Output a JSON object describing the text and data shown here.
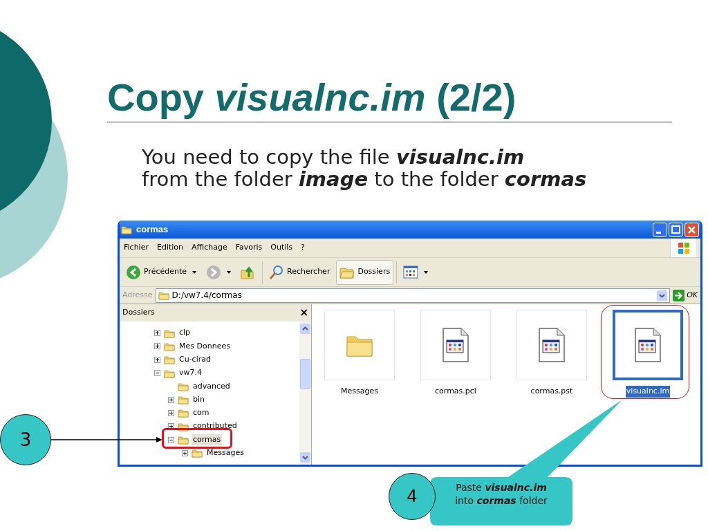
{
  "slide": {
    "title": "Copy *visualnc.im* (2/2)",
    "body": "You need to copy the file **visualnc.im**\nfrom the folder **image** to the folder **cormas**"
  },
  "window": {
    "title": "cormas",
    "menu": [
      {
        "label": "Fichier"
      },
      {
        "label": "Edition"
      },
      {
        "label": "Affichage"
      },
      {
        "label": "Favoris"
      },
      {
        "label": "Outils"
      },
      {
        "label": "?"
      }
    ],
    "toolbar": [
      {
        "kind": "back",
        "label": "Précédente",
        "pressed": false
      },
      {
        "kind": "forward",
        "pressed": false
      },
      {
        "kind": "up",
        "pressed": false
      },
      {
        "kind": "search",
        "label": "Rechercher",
        "pressed": false
      },
      {
        "kind": "folders",
        "label": "Dossiers",
        "pressed": true
      },
      {
        "kind": "views",
        "pressed": false
      }
    ],
    "address": {
      "label": "Adresse",
      "value": "D:/vw7.4/cormas",
      "go": "OK"
    },
    "folders_pane": {
      "title": "Dossiers",
      "close": "×",
      "tree": [
        {
          "name": "clp",
          "expanded": false,
          "selected": false
        },
        {
          "name": "Mes Donnees",
          "expanded": false,
          "selected": false
        },
        {
          "name": "Cu-cirad",
          "expanded": false,
          "selected": false
        },
        {
          "name": "vw7.4",
          "expanded": true,
          "selected": false,
          "children": [
            {
              "name": "advanced",
              "selected": false
            },
            {
              "name": "bin",
              "expanded": false,
              "selected": false
            },
            {
              "name": "com",
              "expanded": false,
              "selected": false
            },
            {
              "name": "contributed",
              "expanded": false,
              "selected": false
            },
            {
              "name": "cormas",
              "expanded": true,
              "selected": true,
              "children": [
                {
                  "name": "Messages",
                  "expanded": false,
                  "selected": false
                }
              ]
            }
          ]
        }
      ]
    },
    "files": [
      {
        "kind": "folder",
        "name": "Messages",
        "selected": false
      },
      {
        "kind": "document",
        "name": "cormas.pcl",
        "selected": false
      },
      {
        "kind": "document",
        "name": "cormas.pst",
        "selected": false
      },
      {
        "kind": "document",
        "name": "visualnc.im",
        "selected": true
      }
    ]
  },
  "callouts": [
    {
      "kind": "arrow",
      "step": "3"
    },
    {
      "kind": "bubble",
      "step": "4",
      "text": "Paste **visualnc.im**\ninto **cormas** folder"
    }
  ]
}
